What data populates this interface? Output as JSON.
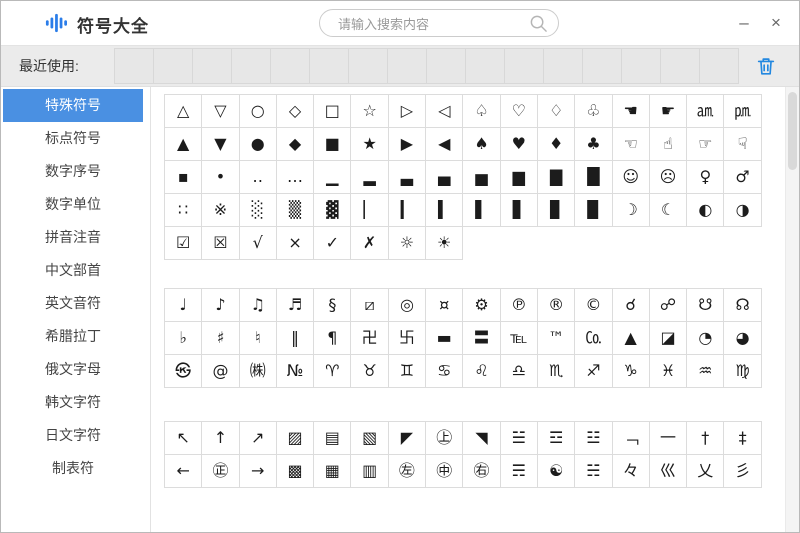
{
  "window": {
    "title": "符号大全",
    "minimize_label": "–",
    "close_label": "×"
  },
  "search": {
    "placeholder": "请输入搜索内容"
  },
  "recent": {
    "label": "最近使用:",
    "slot_count": 16
  },
  "sidebar": {
    "items": [
      {
        "label": "特殊符号",
        "active": true
      },
      {
        "label": "标点符号",
        "active": false
      },
      {
        "label": "数字序号",
        "active": false
      },
      {
        "label": "数字单位",
        "active": false
      },
      {
        "label": "拼音注音",
        "active": false
      },
      {
        "label": "中文部首",
        "active": false
      },
      {
        "label": "英文音符",
        "active": false
      },
      {
        "label": "希腊拉丁",
        "active": false
      },
      {
        "label": "俄文字母",
        "active": false
      },
      {
        "label": "韩文字符",
        "active": false
      },
      {
        "label": "日文字符",
        "active": false
      },
      {
        "label": "制表符",
        "active": false
      }
    ]
  },
  "symbol_blocks": [
    {
      "rows": [
        [
          "△",
          "▽",
          "○",
          "◇",
          "□",
          "☆",
          "▷",
          "◁",
          "♤",
          "♡",
          "♢",
          "♧",
          "☚",
          "☛",
          "㏂",
          "㏘"
        ],
        [
          "▲",
          "▼",
          "●",
          "◆",
          "■",
          "★",
          "▶",
          "◀",
          "♠",
          "♥",
          "♦",
          "♣",
          "☜",
          "☝",
          "☞",
          "☟"
        ],
        [
          "▪",
          "•",
          "‥",
          "…",
          "▁",
          "▂",
          "▃",
          "▄",
          "▅",
          "▆",
          "▇",
          "█",
          "☺",
          "☹",
          "♀",
          "♂"
        ],
        [
          "∷",
          "※",
          "░",
          "▒",
          "▓",
          "▏",
          "▎",
          "▍",
          "▌",
          "▋",
          "▊",
          "▉",
          "☽",
          "☾",
          "◐",
          "◑"
        ],
        [
          "☑",
          "☒",
          "√",
          "×",
          "✓",
          "✗",
          "☼",
          "☀"
        ]
      ]
    },
    {
      "rows": [
        [
          "♩",
          "♪",
          "♫",
          "♬",
          "§",
          "⧄",
          "◎",
          "¤",
          "⚙",
          "℗",
          "®",
          "©",
          "☌",
          "☍",
          "☋",
          "☊"
        ],
        [
          "♭",
          "♯",
          "♮",
          "‖",
          "¶",
          "卍",
          "卐",
          "▬",
          "〓",
          "℡",
          "™",
          "㏇",
          "▲",
          "◪",
          "◔",
          "◕"
        ],
        [
          "㉿",
          "@",
          "㈱",
          "№",
          "♈",
          "♉",
          "♊",
          "♋",
          "♌",
          "♎",
          "♏",
          "♐",
          "♑",
          "♓",
          "♒",
          "♍"
        ]
      ]
    },
    {
      "rows": [
        [
          "↖",
          "↑",
          "↗",
          "▨",
          "▤",
          "▧",
          "◤",
          "㊤",
          "◥",
          "☱",
          "☲",
          "☳",
          "﹁",
          "一",
          "†",
          "‡"
        ],
        [
          "←",
          "㊣",
          "→",
          "▩",
          "▦",
          "▥",
          "㊧",
          "㊥",
          "㊨",
          "☴",
          "☯",
          "☵",
          "々",
          "巛",
          "乂",
          "彡"
        ]
      ]
    }
  ],
  "colors": {
    "accent": "#4a90e2",
    "trash": "#2388e0",
    "logo": "#2b7de9"
  }
}
